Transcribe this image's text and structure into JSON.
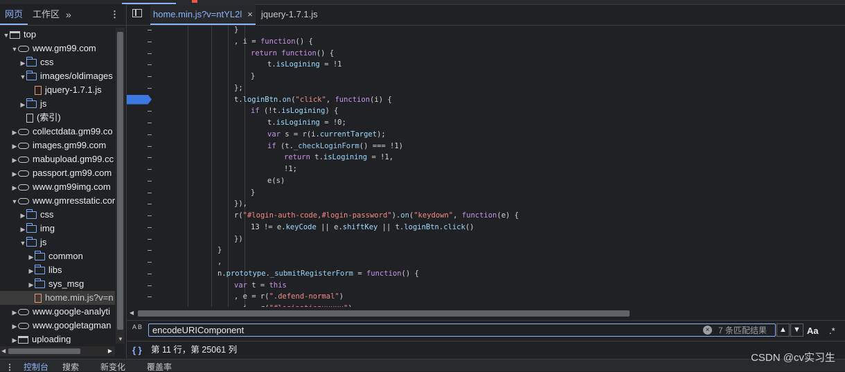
{
  "navigator": {
    "tabs": [
      "网页",
      "工作区"
    ],
    "more": "»",
    "menu": "⋮",
    "tree": [
      {
        "label": "top",
        "icon": "frame",
        "level": 0,
        "open": true
      },
      {
        "label": "www.gm99.com",
        "icon": "cloud",
        "level": 1,
        "open": true
      },
      {
        "label": "css",
        "icon": "folder",
        "level": 2,
        "open": false
      },
      {
        "label": "images/oldimages",
        "icon": "folder",
        "level": 2,
        "open": true
      },
      {
        "label": "jquery-1.7.1.js",
        "icon": "file-js",
        "level": 3
      },
      {
        "label": "js",
        "icon": "folder",
        "level": 2,
        "open": false
      },
      {
        "label": "(索引)",
        "icon": "file",
        "level": 2
      },
      {
        "label": "collectdata.gm99.co",
        "icon": "cloud",
        "level": 1,
        "open": false
      },
      {
        "label": "images.gm99.com",
        "icon": "cloud",
        "level": 1,
        "open": false
      },
      {
        "label": "mabupload.gm99.cc",
        "icon": "cloud",
        "level": 1,
        "open": false
      },
      {
        "label": "passport.gm99.com",
        "icon": "cloud",
        "level": 1,
        "open": false
      },
      {
        "label": "www.gm99img.com",
        "icon": "cloud",
        "level": 1,
        "open": false
      },
      {
        "label": "www.gmresstatic.cor",
        "icon": "cloud",
        "level": 1,
        "open": true
      },
      {
        "label": "css",
        "icon": "folder",
        "level": 2,
        "open": false
      },
      {
        "label": "img",
        "icon": "folder",
        "level": 2,
        "open": false
      },
      {
        "label": "js",
        "icon": "folder",
        "level": 2,
        "open": true
      },
      {
        "label": "common",
        "icon": "folder",
        "level": 3,
        "open": false
      },
      {
        "label": "libs",
        "icon": "folder",
        "level": 3,
        "open": false
      },
      {
        "label": "sys_msg",
        "icon": "folder",
        "level": 3,
        "open": false
      },
      {
        "label": "home.min.js?v=n",
        "icon": "file-js",
        "level": 3,
        "selected": true
      },
      {
        "label": "www.google-analyti",
        "icon": "cloud",
        "level": 1,
        "open": false
      },
      {
        "label": "www.googletagman",
        "icon": "cloud",
        "level": 1,
        "open": false
      },
      {
        "label": "uploading",
        "icon": "frame",
        "level": 1,
        "open": false
      }
    ]
  },
  "editor": {
    "tabs": [
      {
        "label": "home.min.js?v=ntYL2l",
        "close": "×",
        "active": true
      },
      {
        "label": "jquery-1.7.1.js",
        "active": false
      }
    ],
    "code_lines": [
      {
        "indent": 5,
        "html": "}"
      },
      {
        "indent": 5,
        "html": ", i = <span class='k'>function</span>() {"
      },
      {
        "indent": 6,
        "html": "<span class='k'>return</span> <span class='k'>function</span>() {"
      },
      {
        "indent": 7,
        "html": "t.<span class='p'>isLogining</span> = !1"
      },
      {
        "indent": 6,
        "html": "}"
      },
      {
        "indent": 5,
        "html": "};"
      },
      {
        "indent": 5,
        "html": "t.<span class='p'>loginBtn</span>.<span class='f'>on</span>(<span class='s'>\"click\"</span>, <span class='k'>function</span>(i) {",
        "breakpoint": true
      },
      {
        "indent": 6,
        "html": "<span class='k'>if</span> (!t.<span class='p'>isLogining</span>) {"
      },
      {
        "indent": 7,
        "html": "t.<span class='p'>isLogining</span> = !0;"
      },
      {
        "indent": 7,
        "html": "<span class='k'>var</span> s = r(i.<span class='p'>currentTarget</span>);"
      },
      {
        "indent": 7,
        "html": "<span class='k'>if</span> (t.<span class='f'>_checkLoginForm</span>() === !1)"
      },
      {
        "indent": 8,
        "html": "<span class='k'>return</span> t.<span class='p'>isLogining</span> = !1,"
      },
      {
        "indent": 8,
        "html": "!1;"
      },
      {
        "indent": 7,
        "html": "e(s)"
      },
      {
        "indent": 6,
        "html": "}"
      },
      {
        "indent": 5,
        "html": "}),"
      },
      {
        "indent": 5,
        "html": "r(<span class='s'>\"#login-auth-code,#login-password\"</span>).<span class='f'>on</span>(<span class='s'>\"keydown\"</span>, <span class='k'>function</span>(e) {"
      },
      {
        "indent": 6,
        "html": "13 != e.<span class='p'>keyCode</span> || e.<span class='p'>shiftKey</span> || t.<span class='p'>loginBtn</span>.<span class='f'>click</span>()"
      },
      {
        "indent": 5,
        "html": "})"
      },
      {
        "indent": 4,
        "html": "}"
      },
      {
        "indent": 4,
        "html": ","
      },
      {
        "indent": 4,
        "html": "n.<span class='p'>prototype</span>.<span class='f'>_submitRegisterForm</span> = <span class='k'>function</span>() {"
      },
      {
        "indent": 5,
        "html": "<span class='k'>var</span> t = <span class='k'>this</span>"
      },
      {
        "indent": 5,
        "html": ", e = r(<span class='s'>\".defend-normal\"</span>)"
      },
      {
        "indent": 5,
        "html": ", i = r(<span class='s'>\"#loginationuuuuu\"</span>)"
      }
    ]
  },
  "search": {
    "case_icon": "A B",
    "query": "encodeURIComponent",
    "clear": "×",
    "result_count": "7 条匹配结果",
    "prev": "▲",
    "next": "▼",
    "match_case": "Aa",
    "regex": ".*"
  },
  "status": {
    "brackets": "{ }",
    "position": "第 11 行，第 25061 列"
  },
  "drawer": {
    "menu": "⋮",
    "tabs": [
      "控制台",
      "搜索",
      "新变化",
      "覆盖率"
    ]
  },
  "watermark": "CSDN @cv实习生"
}
